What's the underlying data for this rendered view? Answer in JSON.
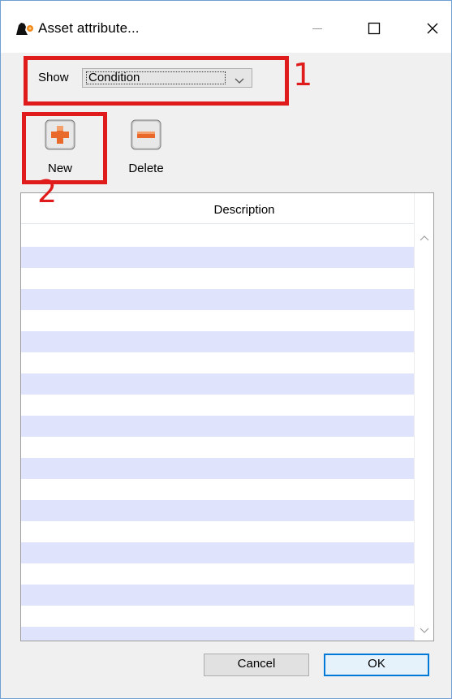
{
  "window": {
    "title": "Asset attribute...",
    "icon": "app-logo-icon",
    "controls": {
      "minimize": "minimize-icon",
      "maximize": "maximize-icon",
      "close": "close-icon"
    }
  },
  "filter": {
    "label": "Show",
    "selected": "Condition",
    "dropdown_icon": "chevron-down-icon"
  },
  "toolbar": {
    "new_label": "New",
    "new_icon": "plus-icon",
    "delete_label": "Delete",
    "delete_icon": "minus-icon"
  },
  "table": {
    "columns": [
      "Description"
    ],
    "rows": []
  },
  "annotations": {
    "marker_1": "1",
    "marker_2": "2",
    "color": "#e01b1b"
  },
  "footer": {
    "cancel_label": "Cancel",
    "ok_label": "OK"
  },
  "colors": {
    "row_shaded": "#dfe3fb",
    "accent": "#0078d7"
  }
}
